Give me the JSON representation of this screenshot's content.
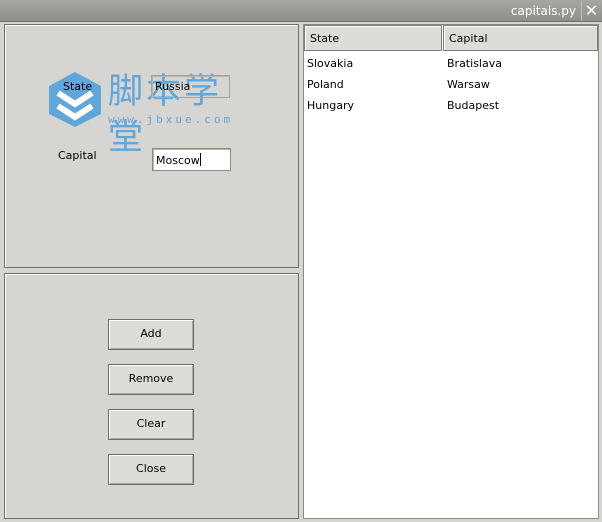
{
  "window": {
    "title": "capitals.py",
    "close_glyph": "✕"
  },
  "form": {
    "state_label": "State",
    "state_value": "Russia",
    "capital_label": "Capital",
    "capital_value": "Moscow"
  },
  "watermark": {
    "text_cn": "脚本学堂",
    "url": "www.jbxue.com",
    "color": "#5fa6da"
  },
  "buttons": {
    "add": "Add",
    "remove": "Remove",
    "clear": "Clear",
    "close": "Close"
  },
  "table": {
    "columns": [
      "State",
      "Capital"
    ],
    "rows": [
      {
        "state": "Slovakia",
        "capital": "Bratislava"
      },
      {
        "state": "Poland",
        "capital": "Warsaw"
      },
      {
        "state": "Hungary",
        "capital": "Budapest"
      }
    ]
  }
}
